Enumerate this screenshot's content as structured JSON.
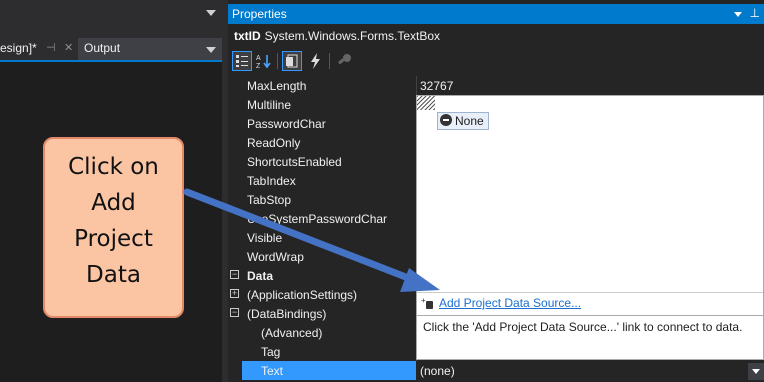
{
  "left": {
    "tab_design": "esign]*",
    "tab_pin": "⊣",
    "tab_close": "✕",
    "tab_output": "Output"
  },
  "properties": {
    "title": "Properties",
    "object_name": "txtID",
    "object_type": "System.Windows.Forms.TextBox",
    "rows": [
      {
        "label": "MaxLength",
        "value": "32767"
      },
      {
        "label": "Multiline"
      },
      {
        "label": "PasswordChar"
      },
      {
        "label": "ReadOnly"
      },
      {
        "label": "ShortcutsEnabled"
      },
      {
        "label": "TabIndex"
      },
      {
        "label": "TabStop"
      },
      {
        "label": "UseSystemPasswordChar"
      },
      {
        "label": "Visible"
      },
      {
        "label": "WordWrap"
      },
      {
        "label": "Data",
        "category": true,
        "expander": "−"
      },
      {
        "label": "(ApplicationSettings)",
        "expander": "+"
      },
      {
        "label": "(DataBindings)",
        "expander": "−"
      },
      {
        "label": "(Advanced)",
        "indent": true
      },
      {
        "label": "Tag",
        "indent": true
      },
      {
        "label": "Text",
        "indent": true,
        "selected": true,
        "value": "(none)"
      }
    ],
    "dropdown": {
      "none_label": "None",
      "add_source_link": "Add Project Data Source...",
      "help_text": "Click the 'Add Project Data Source...' link to connect to data."
    }
  },
  "callout": {
    "lines": [
      "Click on",
      "Add",
      "Project",
      "Data"
    ]
  },
  "colors": {
    "accent": "#007acc",
    "selection": "#3399ff",
    "callout_fill": "#fbc5a3",
    "arrow": "#4472c4"
  }
}
